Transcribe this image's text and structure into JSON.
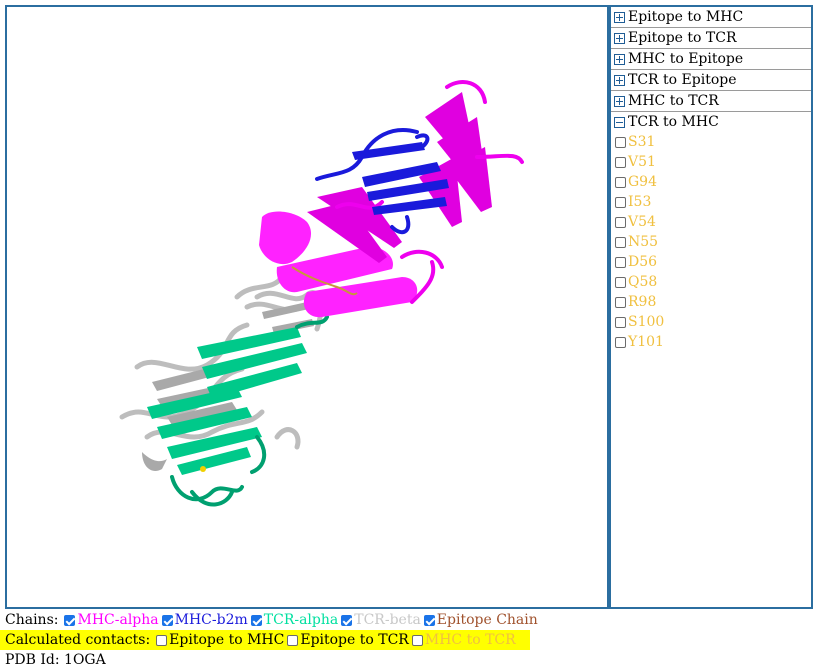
{
  "panel": {
    "sections": [
      {
        "label": "Epitope to MHC"
      },
      {
        "label": "Epitope to TCR"
      },
      {
        "label": "MHC to Epitope"
      },
      {
        "label": "TCR to Epitope"
      },
      {
        "label": "MHC to TCR"
      },
      {
        "label": "TCR to MHC"
      }
    ],
    "residues": [
      "S31",
      "V51",
      "G94",
      "I53",
      "V54",
      "N55",
      "D56",
      "Q58",
      "R98",
      "S100",
      "Y101"
    ],
    "residue_color": "#f0c040"
  },
  "chains": {
    "label": "Chains:",
    "items": [
      {
        "label": "MHC-alpha",
        "color": "#ff00ff",
        "checked": true
      },
      {
        "label": "MHC-b2m",
        "color": "#1a1adb",
        "checked": true
      },
      {
        "label": "TCR-alpha",
        "color": "#00e0a0",
        "checked": true
      },
      {
        "label": "TCR-beta",
        "color": "#c8c8c8",
        "checked": true
      },
      {
        "label": "Epitope Chain",
        "color": "#a0522d",
        "checked": true
      }
    ]
  },
  "contacts": {
    "label": "Calculated contacts:",
    "items": [
      {
        "label": "Epitope to MHC",
        "checked": false
      },
      {
        "label": "Epitope to TCR",
        "checked": false
      },
      {
        "label": "MHC to TCR",
        "checked": false,
        "color": "#f0c040"
      }
    ]
  },
  "pdb": {
    "text": "PDB Id: 1OGA"
  }
}
